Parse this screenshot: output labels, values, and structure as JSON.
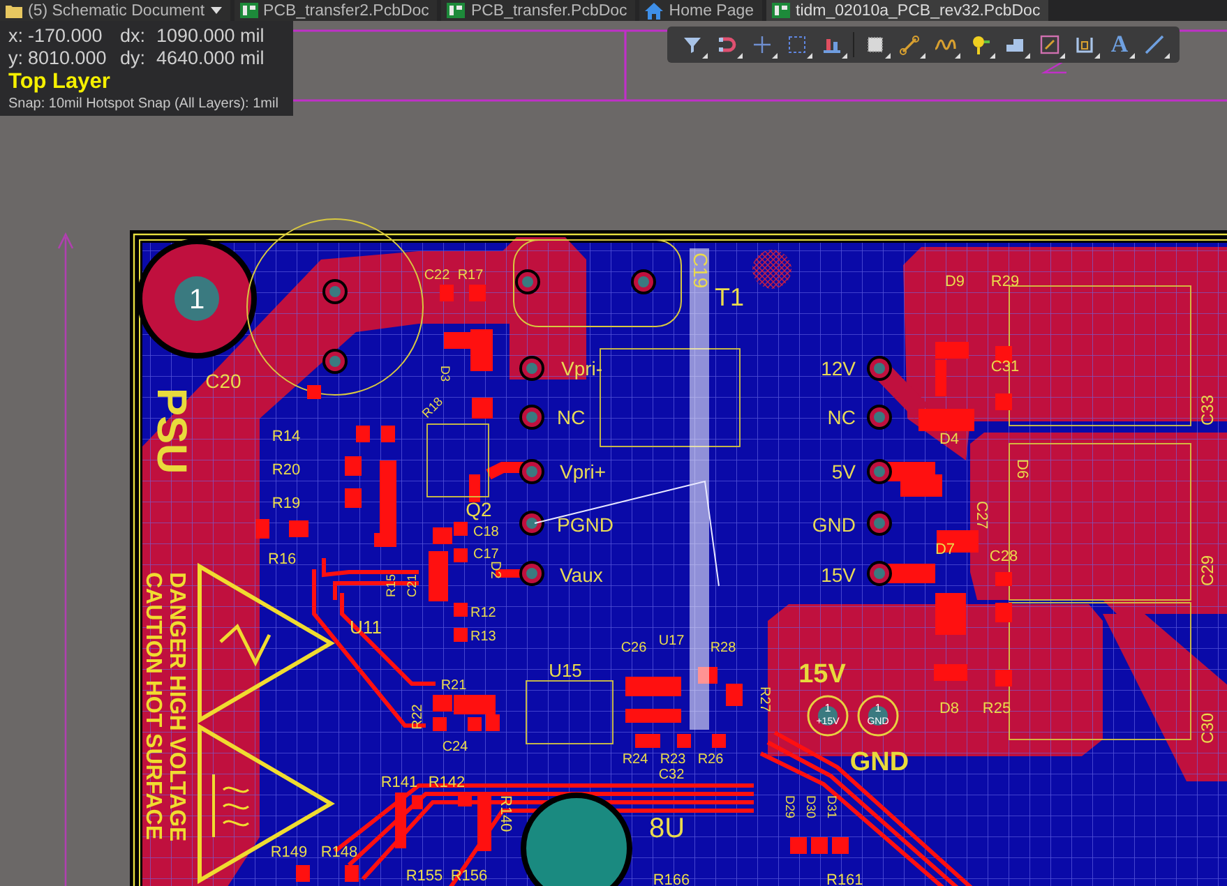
{
  "tabs": [
    {
      "label": "(5) Schematic Document",
      "kind": "schematic",
      "selected": false
    },
    {
      "label": "PCB_transfer2.PcbDoc",
      "kind": "pcb",
      "selected": false
    },
    {
      "label": "PCB_transfer.PcbDoc",
      "kind": "pcb",
      "selected": false
    },
    {
      "label": "Home Page",
      "kind": "home",
      "selected": false
    },
    {
      "label": "tidm_02010a_PCB_rev32.PcbDoc",
      "kind": "pcb",
      "selected": true
    }
  ],
  "info": {
    "rows": [
      {
        "axis": "x:",
        "value": "-170.000",
        "delta_label": "dx:",
        "delta": "1090.000 mil"
      },
      {
        "axis": "y:",
        "value": "8010.000",
        "delta_label": "dy:",
        "delta": "4640.000 mil"
      }
    ],
    "layer": "Top Layer",
    "snap": "Snap: 10mil Hotspot Snap (All Layers): 1mil"
  },
  "toolbar": [
    {
      "kind": "filter"
    },
    {
      "kind": "magnet"
    },
    {
      "kind": "cross"
    },
    {
      "kind": "select"
    },
    {
      "kind": "chart"
    },
    {
      "kind": "chip"
    },
    {
      "kind": "route"
    },
    {
      "kind": "wave"
    },
    {
      "kind": "pin"
    },
    {
      "kind": "step"
    },
    {
      "kind": "box"
    },
    {
      "kind": "bracket"
    },
    {
      "kind": "text",
      "glyph": "A"
    },
    {
      "kind": "line"
    }
  ],
  "board": {
    "labels": [
      {
        "text": "1",
        "kind": "pad_number"
      },
      {
        "text": "C22",
        "kind": "silk"
      },
      {
        "text": "R17",
        "kind": "silk"
      },
      {
        "text": "C19",
        "kind": "silk"
      },
      {
        "text": "T1",
        "kind": "silk"
      },
      {
        "text": "C20",
        "kind": "silk"
      },
      {
        "text": "D3",
        "kind": "silk"
      },
      {
        "text": "R18",
        "kind": "silk"
      },
      {
        "text": "R14",
        "kind": "silk"
      },
      {
        "text": "R20",
        "kind": "silk"
      },
      {
        "text": "R19",
        "kind": "silk"
      },
      {
        "text": "Q2",
        "kind": "silk"
      },
      {
        "text": "C18",
        "kind": "silk"
      },
      {
        "text": "C17",
        "kind": "silk"
      },
      {
        "text": "R16",
        "kind": "silk"
      },
      {
        "text": "R15",
        "kind": "silk"
      },
      {
        "text": "C21",
        "kind": "silk"
      },
      {
        "text": "D2",
        "kind": "silk"
      },
      {
        "text": "R12",
        "kind": "silk"
      },
      {
        "text": "R13",
        "kind": "silk"
      },
      {
        "text": "U11",
        "kind": "silk"
      },
      {
        "text": "C26",
        "kind": "silk"
      },
      {
        "text": "U17",
        "kind": "silk"
      },
      {
        "text": "R28",
        "kind": "silk"
      },
      {
        "text": "U15",
        "kind": "silk"
      },
      {
        "text": "R21",
        "kind": "silk"
      },
      {
        "text": "R22",
        "kind": "silk"
      },
      {
        "text": "C24",
        "kind": "silk"
      },
      {
        "text": "R27",
        "kind": "silk"
      },
      {
        "text": "R24",
        "kind": "silk"
      },
      {
        "text": "R23",
        "kind": "silk"
      },
      {
        "text": "R26",
        "kind": "silk"
      },
      {
        "text": "C32",
        "kind": "silk"
      },
      {
        "text": "R141",
        "kind": "silk"
      },
      {
        "text": "R142",
        "kind": "silk"
      },
      {
        "text": "R140",
        "kind": "silk"
      },
      {
        "text": "8U",
        "kind": "silk"
      },
      {
        "text": "R149",
        "kind": "silk"
      },
      {
        "text": "R148",
        "kind": "silk"
      },
      {
        "text": "R155",
        "kind": "silk"
      },
      {
        "text": "R156",
        "kind": "silk"
      },
      {
        "text": "R166",
        "kind": "silk"
      },
      {
        "text": "D29",
        "kind": "silk"
      },
      {
        "text": "D30",
        "kind": "silk"
      },
      {
        "text": "D31",
        "kind": "silk"
      },
      {
        "text": "R161",
        "kind": "silk"
      },
      {
        "text": "D9",
        "kind": "silk"
      },
      {
        "text": "R29",
        "kind": "silk"
      },
      {
        "text": "C31",
        "kind": "silk"
      },
      {
        "text": "C33",
        "kind": "silk"
      },
      {
        "text": "D4",
        "kind": "silk"
      },
      {
        "text": "D6",
        "kind": "silk"
      },
      {
        "text": "C27",
        "kind": "silk"
      },
      {
        "text": "D7",
        "kind": "silk"
      },
      {
        "text": "C28",
        "kind": "silk"
      },
      {
        "text": "C29",
        "kind": "silk"
      },
      {
        "text": "D8",
        "kind": "silk"
      },
      {
        "text": "R25",
        "kind": "silk"
      },
      {
        "text": "C30",
        "kind": "silk"
      },
      {
        "text": "Vpri-",
        "kind": "net"
      },
      {
        "text": "NC",
        "kind": "net"
      },
      {
        "text": "Vpri+",
        "kind": "net"
      },
      {
        "text": "PGND",
        "kind": "net"
      },
      {
        "text": "Vaux",
        "kind": "net"
      },
      {
        "text": "12V",
        "kind": "net"
      },
      {
        "text": "NC",
        "kind": "net"
      },
      {
        "text": "5V",
        "kind": "net"
      },
      {
        "text": "GND",
        "kind": "net"
      },
      {
        "text": "15V",
        "kind": "net"
      },
      {
        "text": "PSU",
        "kind": "bold"
      },
      {
        "text": "15V",
        "kind": "bold"
      },
      {
        "text": "GND",
        "kind": "bold"
      },
      {
        "text": "DANGER HIGH VOLTAGE",
        "kind": "warning"
      },
      {
        "text": "CAUTION HOT SURFACE",
        "kind": "warning"
      },
      {
        "text": "1",
        "kind": "pad_number"
      },
      {
        "text": "+15V",
        "kind": "pad_net"
      },
      {
        "text": "1",
        "kind": "pad_number"
      },
      {
        "text": "GND",
        "kind": "pad_net"
      }
    ]
  }
}
